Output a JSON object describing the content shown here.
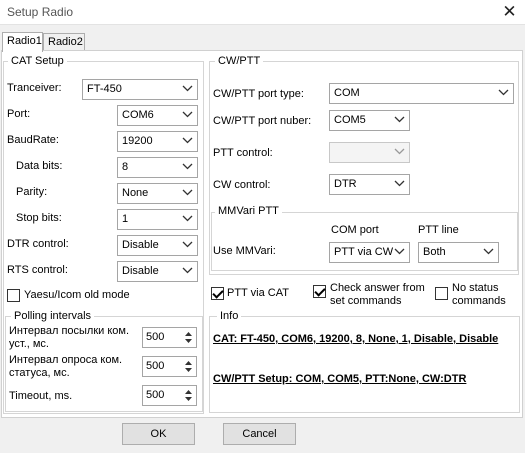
{
  "window": {
    "title": "Setup Radio",
    "close_glyph": "✕"
  },
  "tabs": [
    "Radio1",
    "Radio2"
  ],
  "cat": {
    "title": "CAT Setup",
    "transceiver": {
      "label": "Tranceiver:",
      "value": "FT-450"
    },
    "port": {
      "label": "Port:",
      "value": "COM6"
    },
    "baud": {
      "label": "BaudRate:",
      "value": "19200"
    },
    "databits": {
      "label": "Data bits:",
      "value": "8"
    },
    "parity": {
      "label": "Parity:",
      "value": "None"
    },
    "stopbits": {
      "label": "Stop bits:",
      "value": "1"
    },
    "dtr": {
      "label": "DTR control:",
      "value": "Disable"
    },
    "rts": {
      "label": "RTS control:",
      "value": "Disable"
    },
    "yaesu_old": {
      "label": "Yaesu/Icom old mode",
      "checked": false
    }
  },
  "polling": {
    "title": "Polling intervals",
    "send_interval": {
      "label": "Интервал посылки ком. уст., мс.",
      "value": "500"
    },
    "status_interval": {
      "label": "Интервал опроса ком. статуса, мс.",
      "value": "500"
    },
    "timeout": {
      "label": "Timeout, ms.",
      "value": "500"
    }
  },
  "cwptt": {
    "title": "CW/PTT",
    "port_type": {
      "label": "CW/PTT port type:",
      "value": "COM"
    },
    "port_number": {
      "label": "CW/PTT port nuber:",
      "value": "COM5"
    },
    "ptt_control": {
      "label": "PTT control:",
      "value": ""
    },
    "cw_control": {
      "label": "CW control:",
      "value": "DTR"
    }
  },
  "mmvari": {
    "title": "MMVari PTT",
    "label": "Use MMVari:",
    "com_port_header": "COM port",
    "ptt_line_header": "PTT line",
    "com_port_value": "PTT via CW",
    "ptt_line_value": "Both"
  },
  "options": {
    "ptt_via_cat": {
      "label": "PTT via CAT",
      "checked": true
    },
    "check_answer": {
      "label": "Check answer from set commands",
      "checked": true
    },
    "no_status": {
      "label": "No status commands",
      "checked": false
    }
  },
  "info": {
    "title": "Info",
    "cat_line": "CAT: FT-450, COM6, 19200, 8, None, 1, Disable, Disable",
    "cwptt_line": "CW/PTT Setup: COM, COM5, PTT:None, CW:DTR"
  },
  "buttons": {
    "ok": "OK",
    "cancel": "Cancel"
  }
}
